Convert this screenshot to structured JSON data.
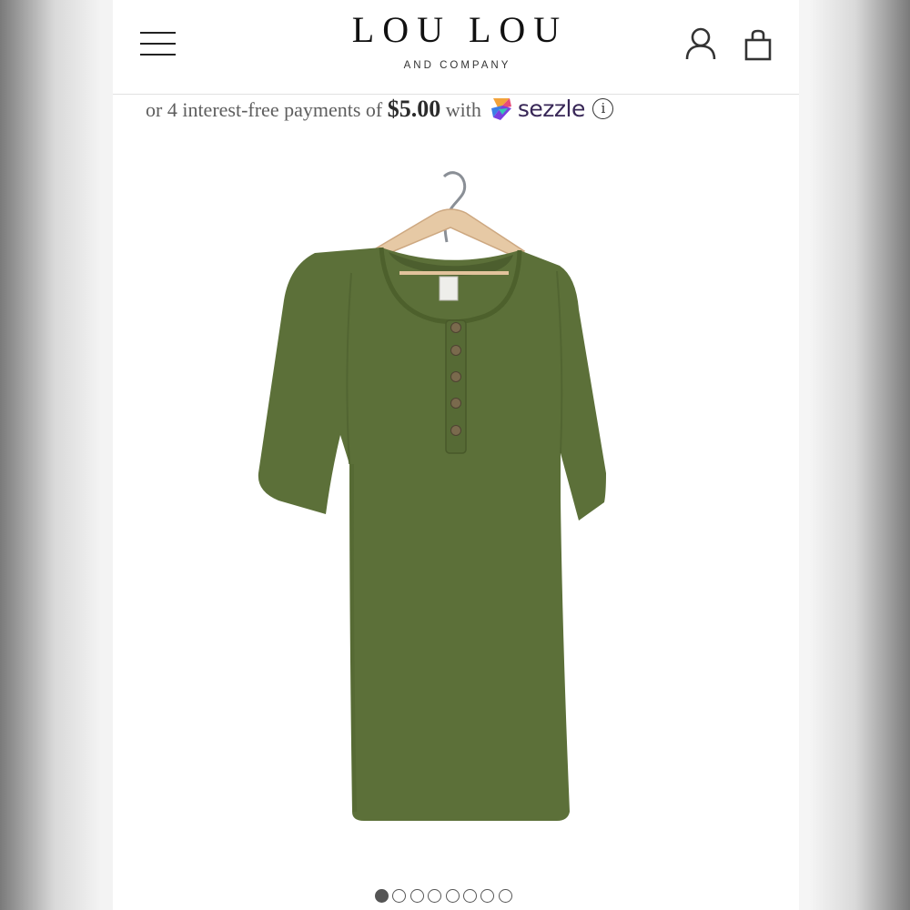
{
  "header": {
    "logo_main": "LOU LOU",
    "logo_sub": "AND COMPANY",
    "menu_icon": "hamburger-menu-icon",
    "account_icon": "user-account-icon",
    "cart_icon": "shopping-bag-icon"
  },
  "payment": {
    "prefix": "or 4 interest-free payments of",
    "amount": "$5.00",
    "middle": "with",
    "provider": "sezzle",
    "info_symbol": "i",
    "brand_color": "#382757"
  },
  "product": {
    "image_icon": "olive-henley-dress-image",
    "color": "#5c7039"
  },
  "carousel": {
    "total": 8,
    "active": 1
  }
}
